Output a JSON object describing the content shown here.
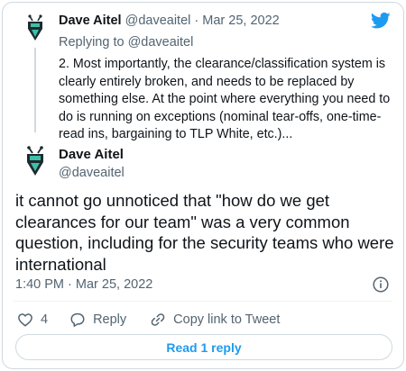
{
  "icons": {
    "twitter": "twitter-bird-icon",
    "info": "info-icon",
    "like": "heart-icon",
    "reply": "speech-bubble-icon",
    "copy_link": "link-icon"
  },
  "colors": {
    "accent": "#1d9bf0",
    "text": "#0f1419",
    "muted": "#536471",
    "border": "#cfd9de"
  },
  "parent_tweet": {
    "name": "Dave Aitel",
    "handle": "@daveaitel",
    "separator": "·",
    "date": "Mar 25, 2022",
    "replying_to_prefix": "Replying to ",
    "replying_to_handle": "@daveaitel",
    "text": "2. Most importantly, the clearance/classification system is clearly entirely broken, and needs to be replaced by something else. At the point where everything you need to do is running on exceptions (nominal tear-offs, one-time-read ins, bargaining to TLP White, etc.)..."
  },
  "main_tweet": {
    "name": "Dave Aitel",
    "handle": "@daveaitel",
    "text": "it cannot go unnoticed that \"how do we get clearances for our team\" was a very common question, including for the security teams who were international",
    "timestamp": "1:40 PM · Mar 25, 2022"
  },
  "actions": {
    "likes_count": "4",
    "reply_label": "Reply",
    "copy_link_label": "Copy link to Tweet"
  },
  "read_button": {
    "label": "Read 1 reply"
  }
}
